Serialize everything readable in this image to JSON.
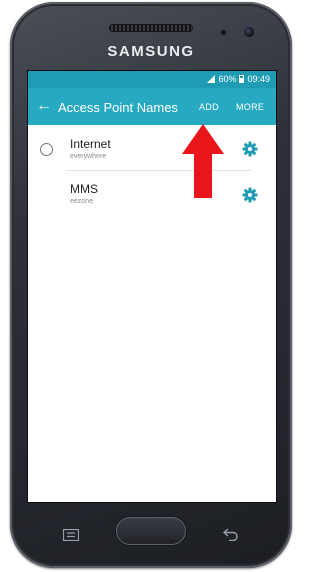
{
  "device": {
    "brand": "SAMSUNG"
  },
  "status_bar": {
    "battery": "60%",
    "time": "09:49"
  },
  "app_bar": {
    "title": "Access Point Names",
    "back_icon": "back-arrow-icon",
    "add_label": "ADD",
    "more_label": "MORE"
  },
  "apn_list": [
    {
      "name": "Internet",
      "apn": "everywhere",
      "selected": false
    },
    {
      "name": "MMS",
      "apn": "eezone",
      "selected": false
    }
  ],
  "colors": {
    "status_bar": "#1f9bb3",
    "app_bar": "#27a9c2",
    "gear": "#1f9bb3",
    "annotation_arrow": "#e8151b"
  },
  "annotation": {
    "type": "arrow",
    "points_to": "add-button"
  }
}
